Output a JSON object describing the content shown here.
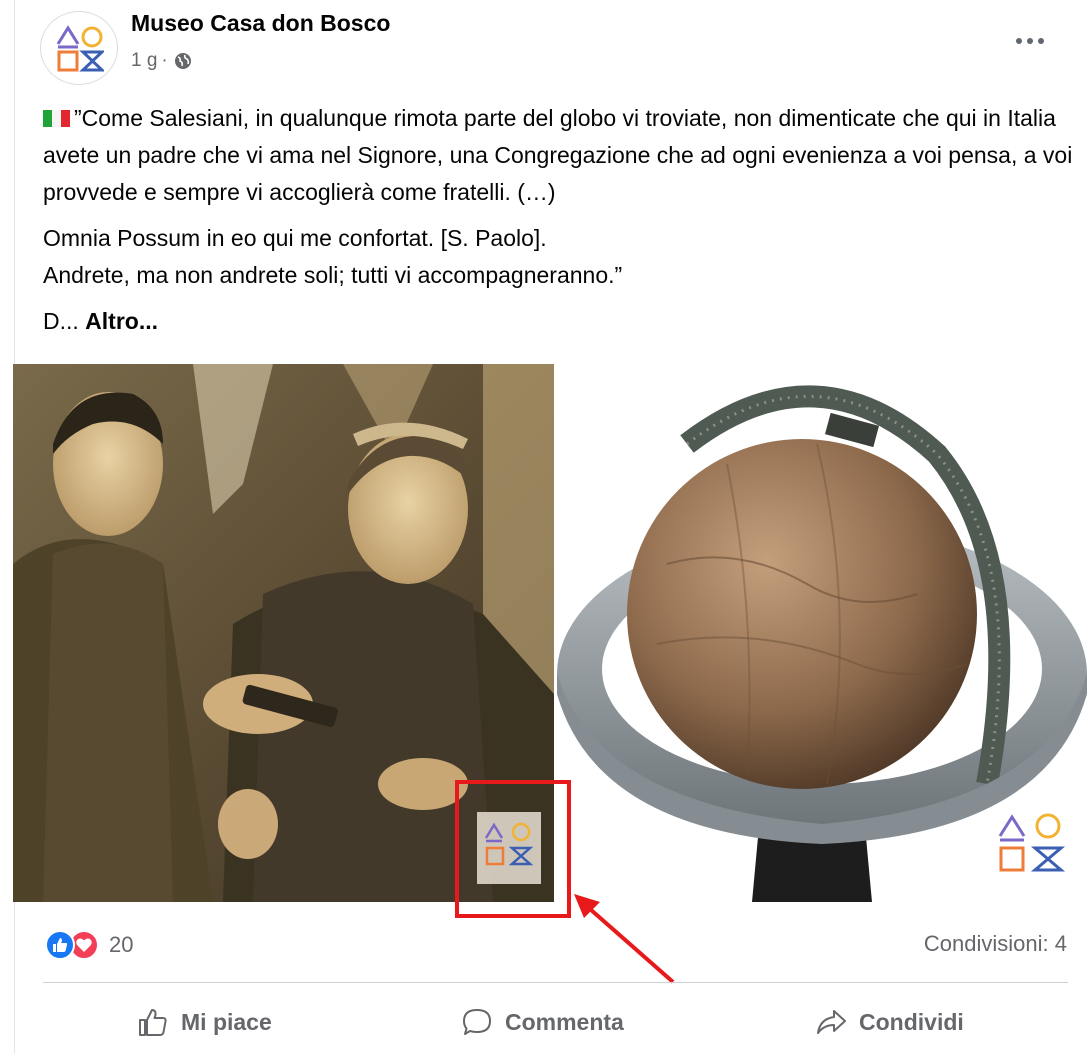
{
  "post": {
    "page_name": "Museo Casa don Bosco",
    "time": "1 g",
    "separator": "·",
    "privacy_icon": "globe-icon",
    "more_icon": "more-options-icon",
    "paragraphs": {
      "p1": "”Come Salesiani, in qualunque rimota parte del globo vi troviate, non dimenticate che qui in Italia avete un padre che vi ama nel Signore, una Congregazione che ad ogni evenienza a voi pensa, a voi provvede e sempre vi accoglierà come fratelli. (…)",
      "p2_line1": "Omnia Possum in eo qui me confortat. [S. Paolo].",
      "p2_line2": "Andrete, ma non andrete soli; tutti vi accompagneranno.”",
      "p3_prefix": "D...",
      "see_more": "Altro..."
    },
    "flag_icon": "italy-flag-icon",
    "photos": [
      {
        "name": "historic-photo",
        "watermark": "museum-logo-watermark"
      },
      {
        "name": "antique-globe-photo",
        "watermark": "museum-logo-watermark"
      }
    ]
  },
  "engagement": {
    "reactions": [
      "like-reaction-icon",
      "love-reaction-icon"
    ],
    "reaction_count": "20",
    "shares": "Condivisioni: 4"
  },
  "actions": {
    "like": "Mi piace",
    "comment": "Commenta",
    "share": "Condividi"
  },
  "colors": {
    "logo_purple": "#7b68c8",
    "logo_yellow": "#f2b233",
    "logo_orange": "#ef7d3a",
    "logo_blue": "#3b5fb2",
    "annotation_red": "#e8191b",
    "like_blue": "#1877f2",
    "love_red": "#f33e58"
  }
}
